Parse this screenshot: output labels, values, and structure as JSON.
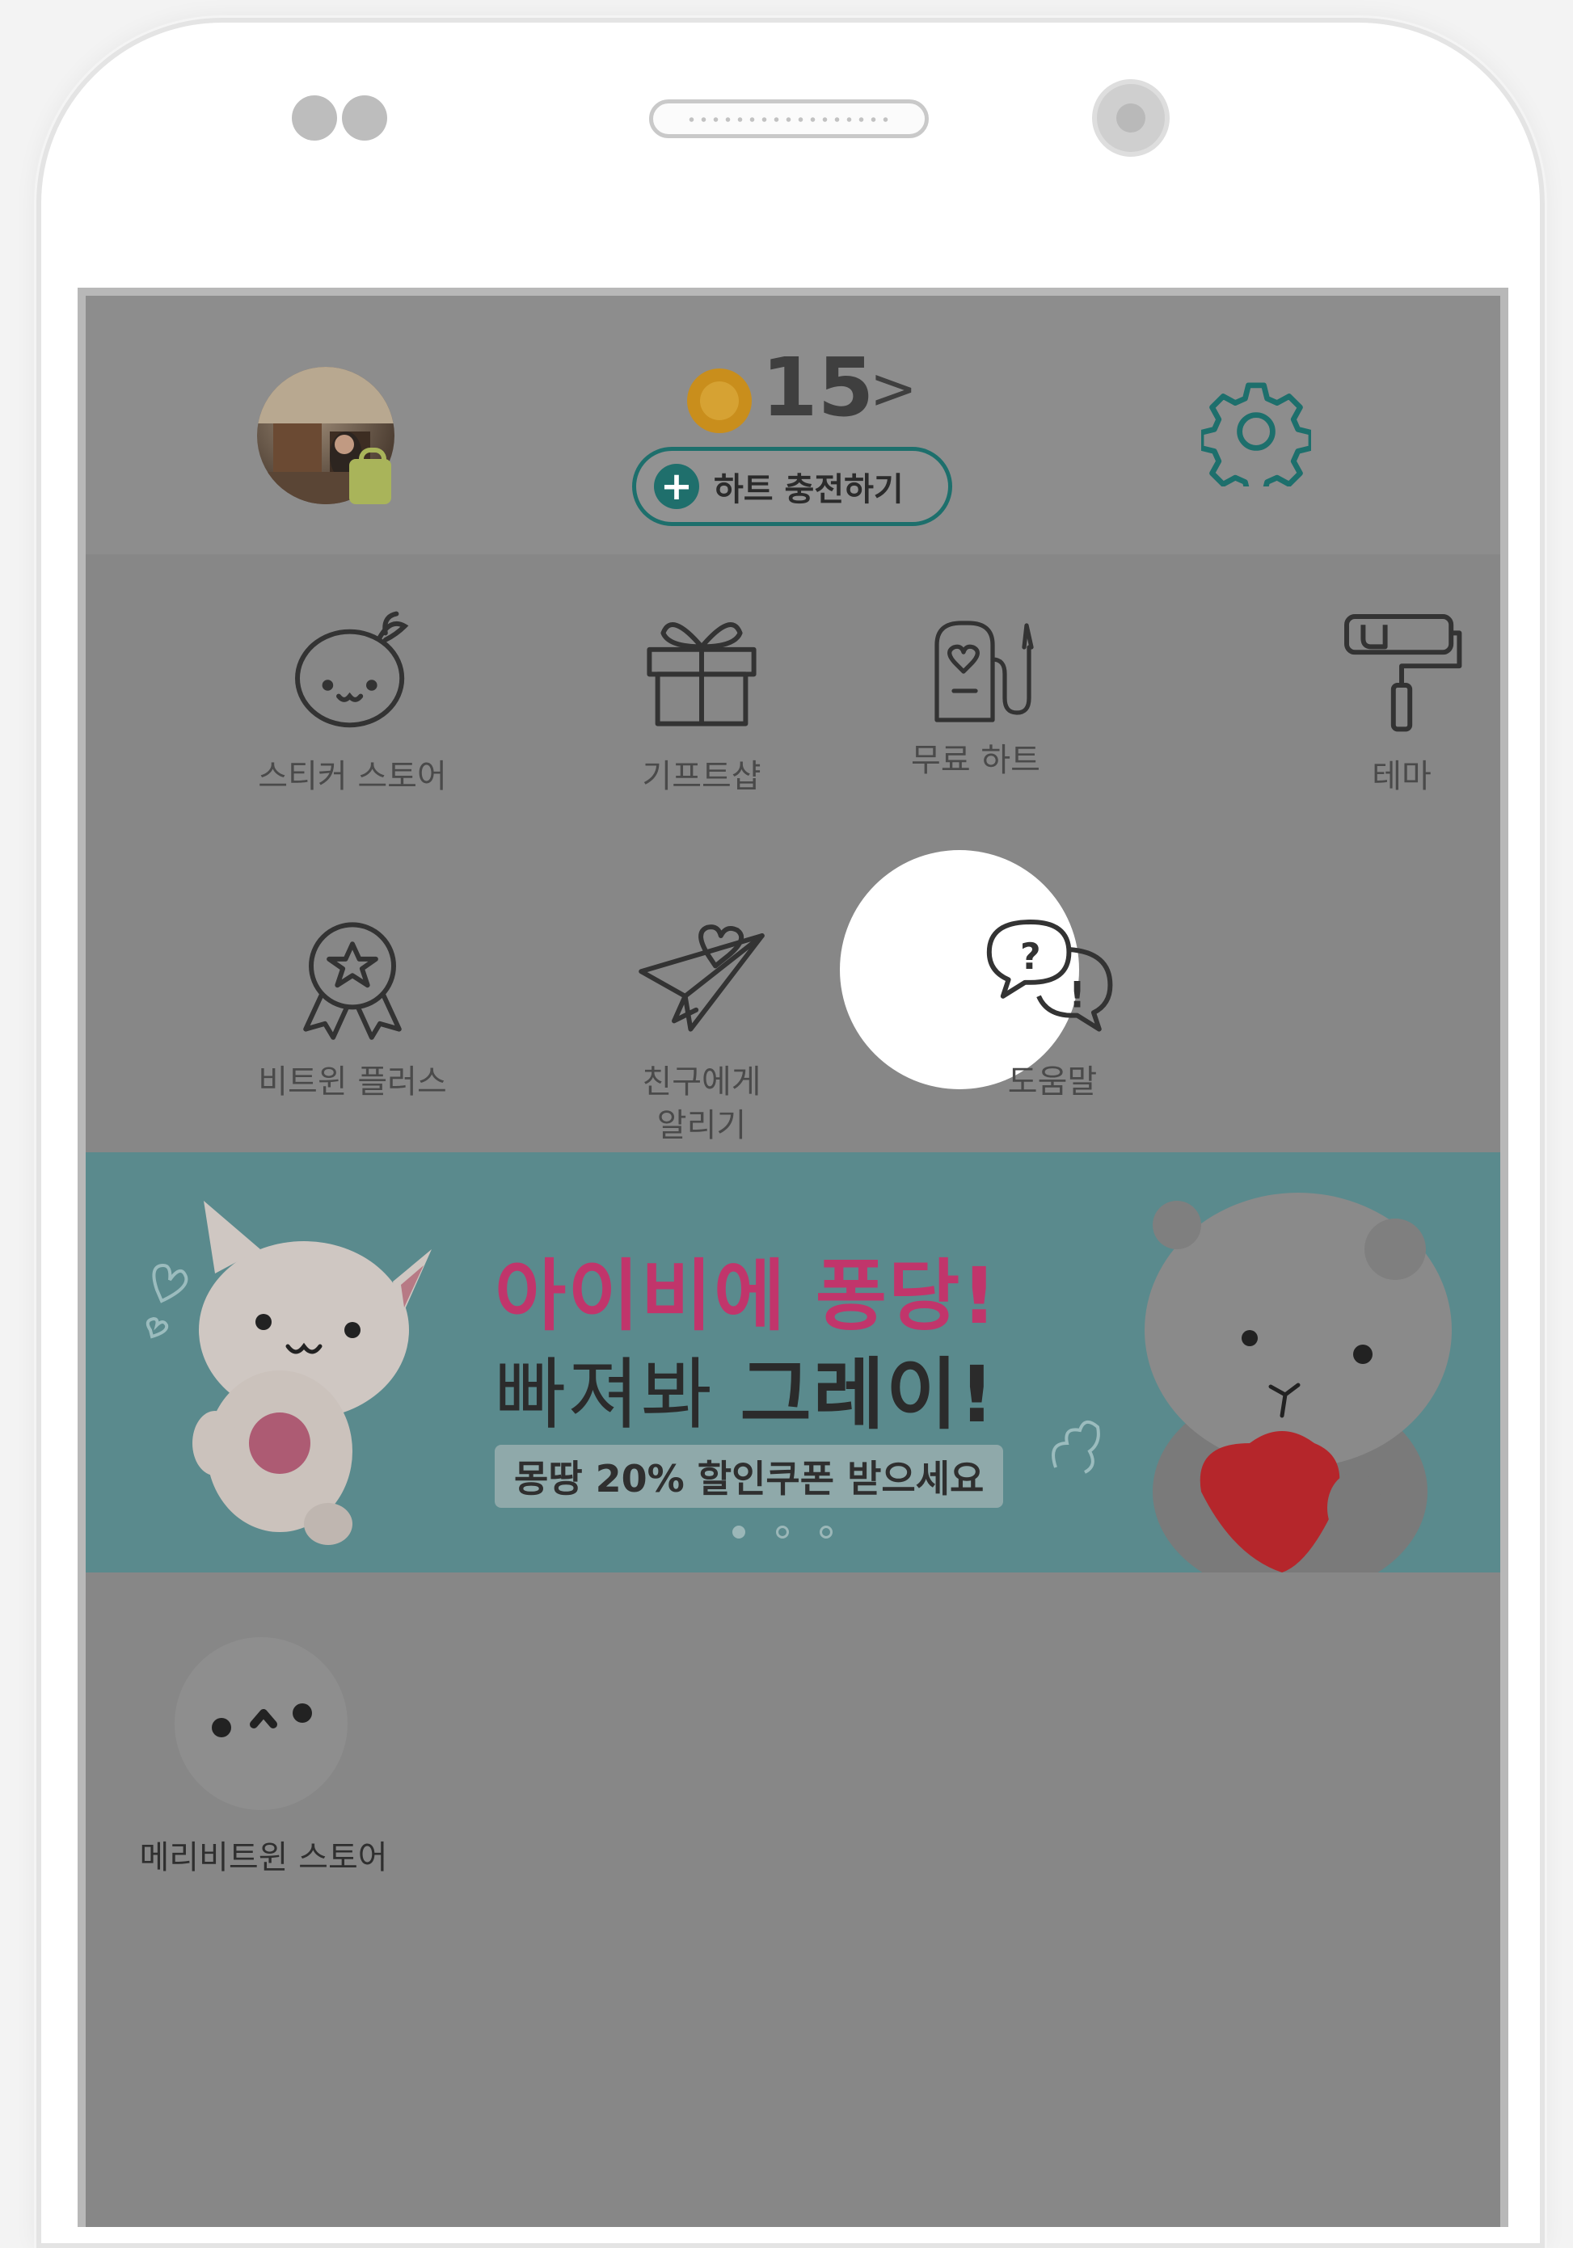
{
  "header": {
    "heart_count": "15",
    "heart_arrow": ">",
    "charge_plus": "+",
    "charge_label": "하트 충전하기"
  },
  "menu": {
    "items": [
      {
        "label": "스티커 스토어",
        "icon": "seal-sticker-icon"
      },
      {
        "label": "기프트샵",
        "icon": "gift-icon"
      },
      {
        "label": "무료 하트",
        "icon": "heart-fuel-pump-icon"
      },
      {
        "label": "테마",
        "icon": "paint-roller-icon"
      },
      {
        "label": "비트윈 플러스",
        "icon": "star-badge-icon"
      },
      {
        "label": "친구에게\n알리기",
        "icon": "paper-plane-heart-icon"
      },
      {
        "label": "도움말",
        "icon": "help-speech-bubbles-icon"
      }
    ]
  },
  "banner": {
    "line1_pink": "아이비",
    "line1_rest": "에 퐁당!",
    "line2_normal": "빠져봐 ",
    "line2_bold": "그레이!",
    "coupon": "몽땅 20% 할인쿠폰 받으세요",
    "page_count": 3,
    "active_page": 1
  },
  "bottom": {
    "store_label": "메리비트윈 스토어"
  },
  "colors": {
    "accent_teal": "#1d6f6c",
    "banner_bg": "#5a8a8d",
    "banner_pink": "#c1356b",
    "coin": "#c98e1c"
  }
}
